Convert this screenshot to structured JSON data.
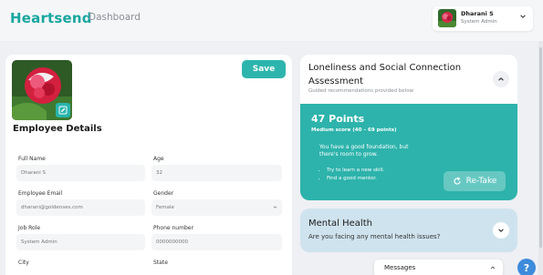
{
  "header": {
    "logo": "Heartsend",
    "nav_dashboard": "Dashboard",
    "user": {
      "name": "Dharani S",
      "role": "System Admin"
    }
  },
  "employee": {
    "save_label": "Save",
    "section_title": "Employee Details",
    "fields": {
      "full_name": {
        "label": "Full Name",
        "value": "Dharani S"
      },
      "age": {
        "label": "Age",
        "value": "32"
      },
      "email": {
        "label": "Employee Email",
        "value": "dharani@goldenses.com"
      },
      "gender": {
        "label": "Gender",
        "value": "Female"
      },
      "job_role": {
        "label": "Job Role",
        "value": "System Admin"
      },
      "phone": {
        "label": "Phone number",
        "value": "0000000000"
      },
      "city": {
        "label": "City"
      },
      "state": {
        "label": "State"
      }
    }
  },
  "loneliness": {
    "title": "Loneliness and Social Connection Assessment",
    "subtitle": "Guided recommendations provided below",
    "points": "47 Points",
    "score_range": "Medium score (40 – 69 points)",
    "message": "You have a good foundation, but there's room to grow.",
    "tips": [
      "Try to learn a new skill.",
      "Find a good mentor."
    ],
    "retake_label": "Re-Take"
  },
  "mental_health": {
    "title": "Mental Health",
    "question": "Are you facing any mental health issues?"
  },
  "messages": {
    "label": "Messages"
  },
  "help": {
    "label": "?"
  },
  "colors": {
    "accent": "#2db3ab",
    "logo": "#19a6a0",
    "mental_bg": "#cfe3ee",
    "help": "#3d8bdb"
  }
}
